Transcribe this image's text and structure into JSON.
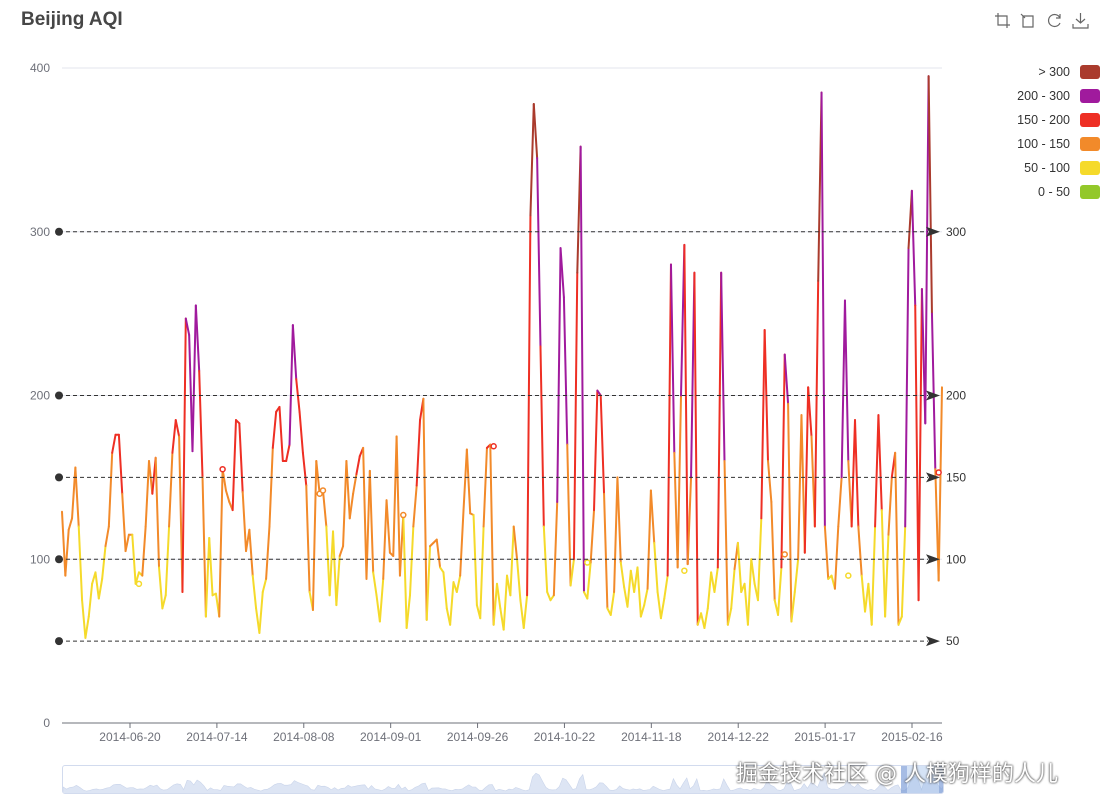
{
  "title": "Beijing AQI",
  "toolbox": {
    "icons": [
      "zoom-icon",
      "zoom-reset-icon",
      "restore-icon",
      "save-image-icon"
    ]
  },
  "legend": [
    {
      "label": "> 300",
      "color": "#aa3b2d"
    },
    {
      "label": "200 - 300",
      "color": "#a01a9d"
    },
    {
      "label": "150 - 200",
      "color": "#ee2f24"
    },
    {
      "label": "100 - 150",
      "color": "#f28a2a"
    },
    {
      "label": "50 - 100",
      "color": "#f5da2b"
    },
    {
      "label": "0 - 50",
      "color": "#93c82a"
    }
  ],
  "watermark": "掘金技术社区 @ 人模狗样的人儿",
  "chart_data": {
    "type": "line",
    "title": "Beijing AQI",
    "xlabel": "",
    "ylabel": "",
    "ylim": [
      0,
      400
    ],
    "yticks": [
      0,
      100,
      200,
      300,
      400
    ],
    "x_ticks": [
      "2014-06-20",
      "2014-07-14",
      "2014-08-08",
      "2014-09-01",
      "2014-09-26",
      "2014-10-22",
      "2014-11-18",
      "2014-12-22",
      "2015-01-17",
      "2015-02-16"
    ],
    "grid": "horizontal",
    "legend_position": "right",
    "mark_lines": [
      {
        "value": 50,
        "label": "50"
      },
      {
        "value": 100,
        "label": "100"
      },
      {
        "value": 150,
        "label": "150"
      },
      {
        "value": 200,
        "label": "200"
      },
      {
        "value": 300,
        "label": "300"
      }
    ],
    "visual_map": [
      {
        "range": "0-50",
        "color": "#93c82a"
      },
      {
        "range": "50-100",
        "color": "#f5da2b"
      },
      {
        "range": "100-150",
        "color": "#f28a2a"
      },
      {
        "range": "150-200",
        "color": "#ee2f24"
      },
      {
        "range": "200-300",
        "color": "#a01a9d"
      },
      {
        "range": ">300",
        "color": "#aa3b2d"
      }
    ],
    "values": [
      129,
      90,
      118,
      125,
      156,
      120,
      75,
      52,
      65,
      85,
      92,
      76,
      88,
      108,
      120,
      165,
      176,
      176,
      140,
      105,
      115,
      115,
      85,
      92,
      90,
      120,
      160,
      140,
      162,
      95,
      70,
      78,
      120,
      165,
      185,
      175,
      80,
      247,
      237,
      166,
      255,
      215,
      150,
      65,
      113,
      78,
      79,
      65,
      155,
      142,
      135,
      130,
      185,
      183,
      141,
      105,
      118,
      90,
      70,
      55,
      80,
      88,
      120,
      168,
      190,
      193,
      160,
      160,
      170,
      243,
      210,
      190,
      165,
      145,
      80,
      69,
      160,
      140,
      142,
      120,
      78,
      117,
      72,
      102,
      108,
      160,
      125,
      140,
      152,
      163,
      168,
      88,
      154,
      92,
      78,
      62,
      88,
      136,
      104,
      102,
      175,
      90,
      127,
      58,
      78,
      120,
      145,
      185,
      198,
      63,
      108,
      110,
      112,
      95,
      92,
      70,
      60,
      86,
      80,
      90,
      130,
      167,
      128,
      127,
      72,
      64,
      120,
      168,
      170,
      60,
      85,
      70,
      57,
      90,
      78,
      120,
      100,
      75,
      58,
      78,
      310,
      378,
      345,
      230,
      120,
      80,
      75,
      78,
      135,
      290,
      260,
      170,
      84,
      100,
      275,
      352,
      80,
      76,
      98,
      130,
      203,
      200,
      140,
      70,
      66,
      80,
      150,
      98,
      83,
      71,
      93,
      80,
      95,
      65,
      72,
      82,
      142,
      110,
      80,
      64,
      76,
      90,
      280,
      165,
      95,
      200,
      292,
      97,
      150,
      275,
      60,
      67,
      58,
      70,
      92,
      80,
      95,
      275,
      160,
      60,
      70,
      94,
      110,
      80,
      85,
      60,
      100,
      85,
      75,
      125,
      240,
      160,
      135,
      75,
      66,
      95,
      225,
      195,
      62,
      80,
      100,
      188,
      104,
      205,
      175,
      120,
      270,
      385,
      120,
      88,
      90,
      82,
      120,
      150,
      258,
      160,
      120,
      185,
      120,
      90,
      68,
      85,
      60,
      120,
      188,
      130,
      65,
      115,
      150,
      165,
      60,
      65,
      120,
      290,
      325,
      255,
      75,
      265,
      183,
      395,
      250,
      155,
      87,
      205
    ],
    "scatter_points": [
      {
        "index": 23,
        "value": 85
      },
      {
        "index": 48,
        "value": 155
      },
      {
        "index": 77,
        "value": 140
      },
      {
        "index": 78,
        "value": 142
      },
      {
        "index": 102,
        "value": 127
      },
      {
        "index": 129,
        "value": 169
      },
      {
        "index": 157,
        "value": 98
      },
      {
        "index": 186,
        "value": 93
      },
      {
        "index": 216,
        "value": 103
      },
      {
        "index": 235,
        "value": 90
      },
      {
        "index": 262,
        "value": 153
      }
    ]
  }
}
